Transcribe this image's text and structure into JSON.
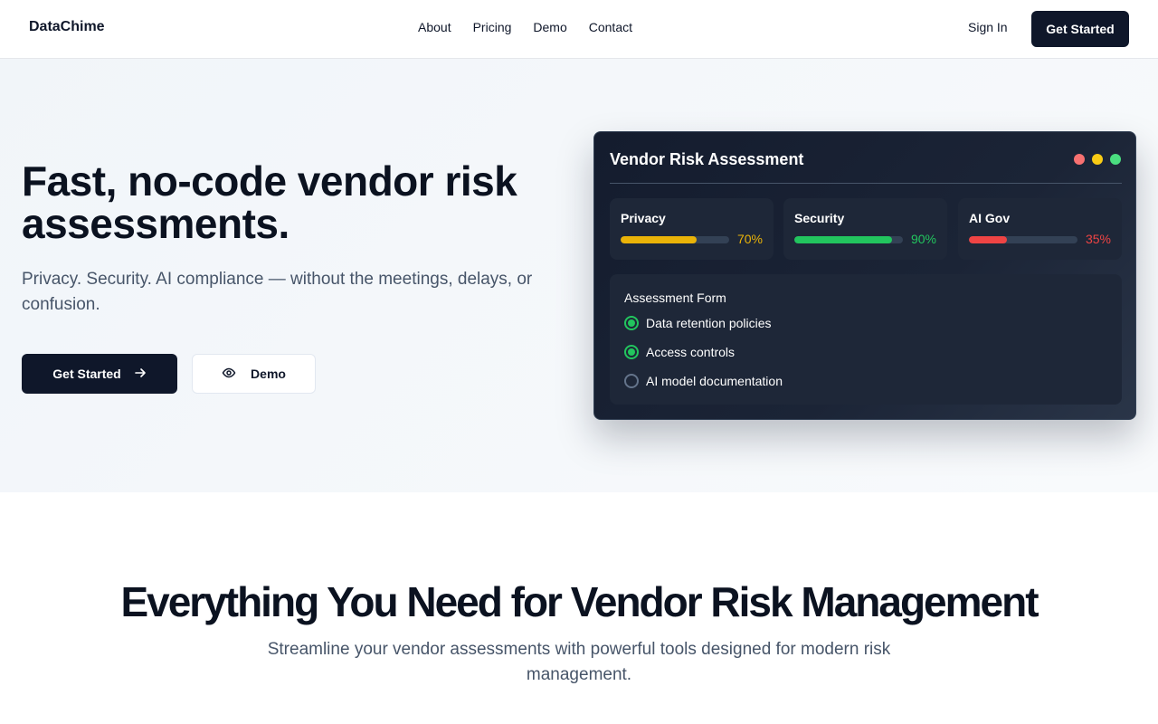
{
  "nav": {
    "brand": "DataChime",
    "links": [
      "About",
      "Pricing",
      "Demo",
      "Contact"
    ],
    "sign_in": "Sign In",
    "cta": "Get Started"
  },
  "hero": {
    "title": "Fast, no-code vendor risk assessments.",
    "subtitle": "Privacy. Security. AI compliance — without the meetings, delays, or confusion.",
    "primary_cta": "Get Started",
    "secondary_cta": "Demo"
  },
  "card": {
    "title": "Vendor Risk Assessment",
    "window_dots": [
      "#f87171",
      "#facc15",
      "#4ade80"
    ],
    "metrics": [
      {
        "label": "Privacy",
        "percent": 70,
        "percent_label": "70%",
        "color": "#eab308"
      },
      {
        "label": "Security",
        "percent": 90,
        "percent_label": "90%",
        "color": "#22c55e"
      },
      {
        "label": "AI Gov",
        "percent": 35,
        "percent_label": "35%",
        "color": "#ef4444"
      }
    ],
    "form": {
      "title": "Assessment Form",
      "items": [
        {
          "label": "Data retention policies",
          "checked": true
        },
        {
          "label": "Access controls",
          "checked": true
        },
        {
          "label": "AI model documentation",
          "checked": false
        }
      ]
    }
  },
  "features": {
    "title": "Everything You Need for Vendor Risk Management",
    "subtitle": "Streamline your vendor assessments with powerful tools designed for modern risk management."
  },
  "icons": {
    "primary_cta_icon": "arrow-right-icon",
    "secondary_cta_icon": "eye-icon"
  }
}
